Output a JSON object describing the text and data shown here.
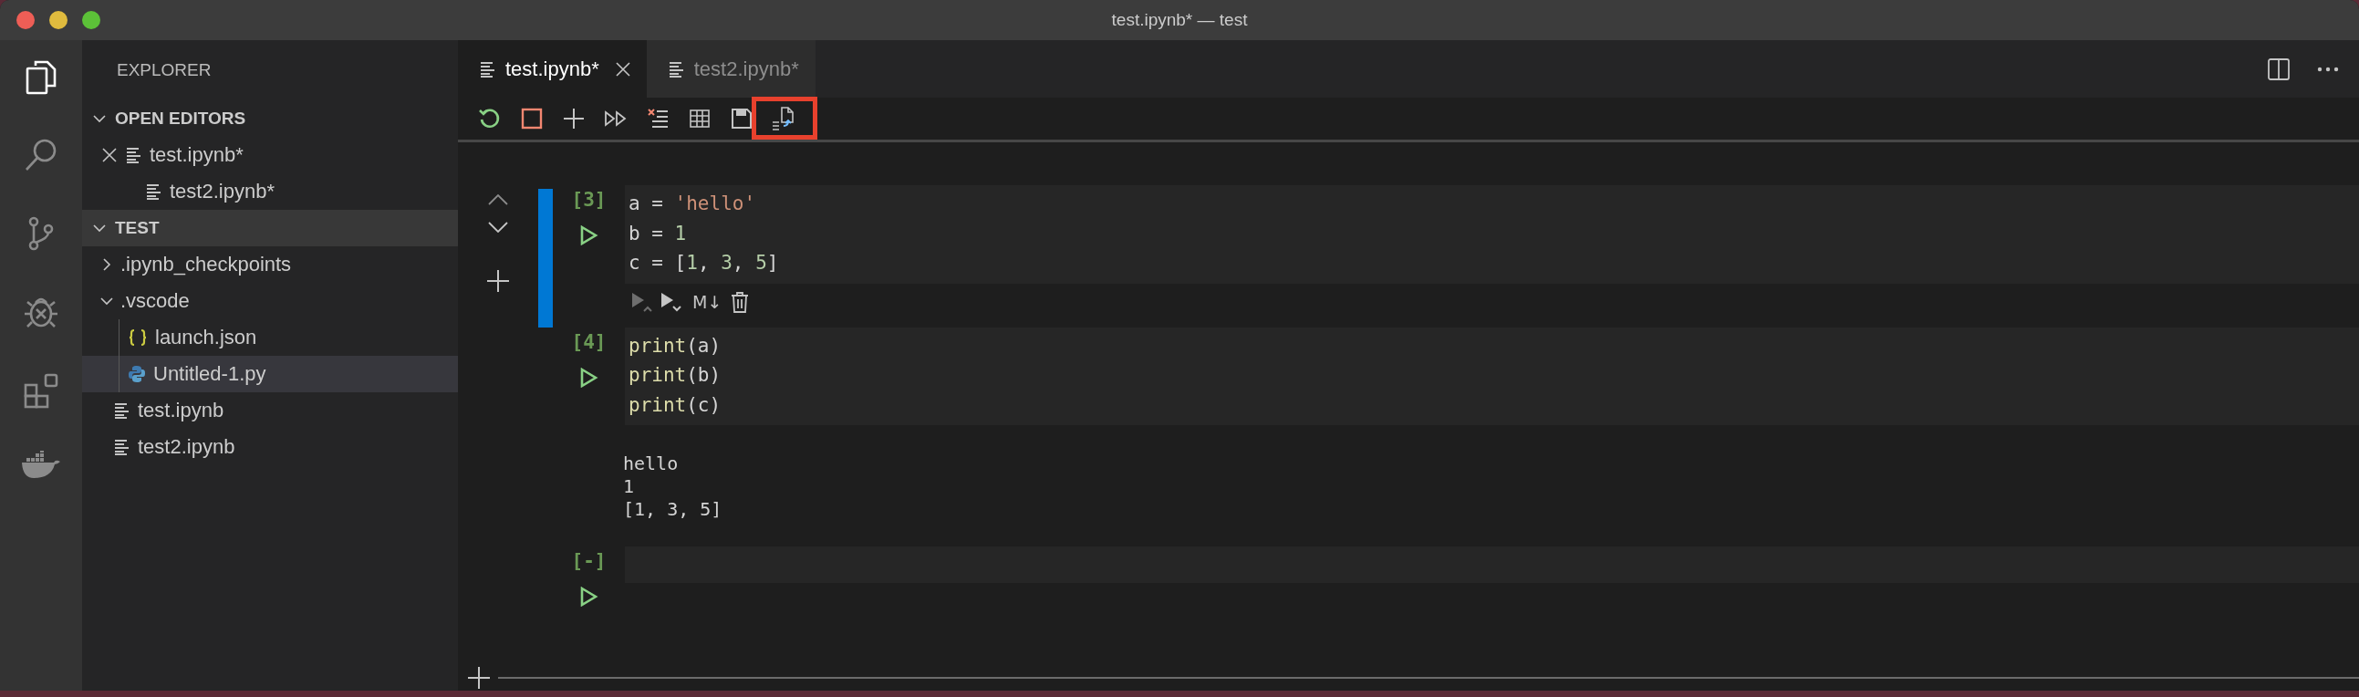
{
  "window": {
    "title": "test.ipynb* — test"
  },
  "activity_bar": [
    {
      "kind": "explorer",
      "selected": true
    },
    {
      "kind": "search",
      "selected": false
    },
    {
      "kind": "source-control",
      "selected": false
    },
    {
      "kind": "debug",
      "selected": false
    },
    {
      "kind": "extensions",
      "selected": false
    },
    {
      "kind": "docker",
      "selected": false
    }
  ],
  "sidebar": {
    "title": "EXPLORER",
    "open_editors": {
      "label": "OPEN EDITORS",
      "expanded": true,
      "items": [
        {
          "name": "test.ipynb*",
          "close_shown": true
        },
        {
          "name": "test2.ipynb*",
          "close_shown": false
        }
      ]
    },
    "folder": {
      "label": "TEST",
      "expanded": true,
      "children": [
        {
          "name": ".ipynb_checkpoints",
          "kind": "folder",
          "expanded": false,
          "selected": false
        },
        {
          "name": ".vscode",
          "kind": "folder",
          "expanded": true,
          "selected": false,
          "children": [
            {
              "name": "launch.json",
              "kind": "json",
              "selected": false
            },
            {
              "name": "Untitled-1.py",
              "kind": "python",
              "selected": true
            }
          ]
        },
        {
          "name": "test.ipynb",
          "kind": "notebook",
          "selected": false
        },
        {
          "name": "test2.ipynb",
          "kind": "notebook",
          "selected": false
        }
      ]
    }
  },
  "tabs": [
    {
      "label": "test.ipynb*",
      "selected": true
    },
    {
      "label": "test2.ipynb*",
      "selected": false
    }
  ],
  "notebook_toolbar": [
    {
      "kind": "restart",
      "highlighted": false
    },
    {
      "kind": "stop",
      "highlighted": false
    },
    {
      "kind": "add",
      "highlighted": false
    },
    {
      "kind": "run-all",
      "highlighted": false
    },
    {
      "kind": "clear",
      "highlighted": false
    },
    {
      "kind": "variables",
      "highlighted": false
    },
    {
      "kind": "save",
      "highlighted": false
    },
    {
      "kind": "export",
      "highlighted": true
    }
  ],
  "cells": [
    {
      "count": "[3]",
      "selected": true,
      "code": [
        [
          {
            "text": "a = ",
            "kind": "plain"
          },
          {
            "text": "'hello'",
            "kind": "string"
          }
        ],
        [
          {
            "text": "b = ",
            "kind": "plain"
          },
          {
            "text": "1",
            "kind": "number"
          }
        ],
        [
          {
            "text": "c = [",
            "kind": "plain"
          },
          {
            "text": "1",
            "kind": "number"
          },
          {
            "text": ", ",
            "kind": "plain"
          },
          {
            "text": "3",
            "kind": "number"
          },
          {
            "text": ", ",
            "kind": "plain"
          },
          {
            "text": "5",
            "kind": "number"
          },
          {
            "text": "]",
            "kind": "plain"
          }
        ]
      ],
      "toolbar": {
        "markdown": "M↓"
      }
    },
    {
      "count": "[4]",
      "selected": false,
      "code": [
        [
          {
            "text": "print",
            "kind": "function"
          },
          {
            "text": "(a)",
            "kind": "plain"
          }
        ],
        [
          {
            "text": "print",
            "kind": "function"
          },
          {
            "text": "(b)",
            "kind": "plain"
          }
        ],
        [
          {
            "text": "print",
            "kind": "function"
          },
          {
            "text": "(c)",
            "kind": "plain"
          }
        ]
      ],
      "output": [
        "hello",
        "1",
        "[1, 3, 5]"
      ]
    },
    {
      "count": "[-]",
      "selected": false
    }
  ]
}
